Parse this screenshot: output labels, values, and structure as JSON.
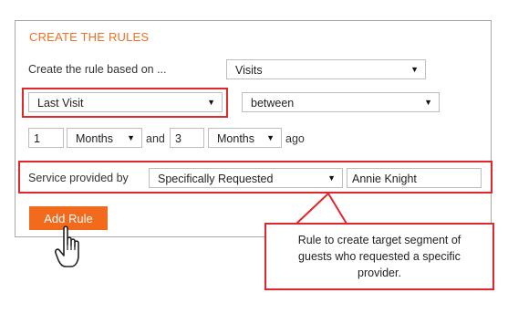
{
  "panel": {
    "title": "CREATE THE RULES"
  },
  "row1": {
    "label": "Create the rule based on ...",
    "select": "Visits"
  },
  "row2": {
    "field": "Last Visit",
    "operator": "between"
  },
  "row3": {
    "from_value": "1",
    "from_unit": "Months",
    "and_label": "and",
    "to_value": "3",
    "to_unit": "Months",
    "ago_label": "ago"
  },
  "row4": {
    "label": "Service provided by",
    "select": "Specifically Requested",
    "provider": "Annie Knight"
  },
  "button": {
    "add_rule": "Add Rule"
  },
  "callout": {
    "lines": [
      "Rule to create target segment of",
      "guests who requested a specific",
      "provider."
    ]
  },
  "icons": {
    "dropdown": "triangle-down-icon",
    "cursor": "hand-pointer-icon"
  },
  "colors": {
    "accent": "#f26b1d",
    "title": "#f07020",
    "highlight": "#e0282c"
  }
}
